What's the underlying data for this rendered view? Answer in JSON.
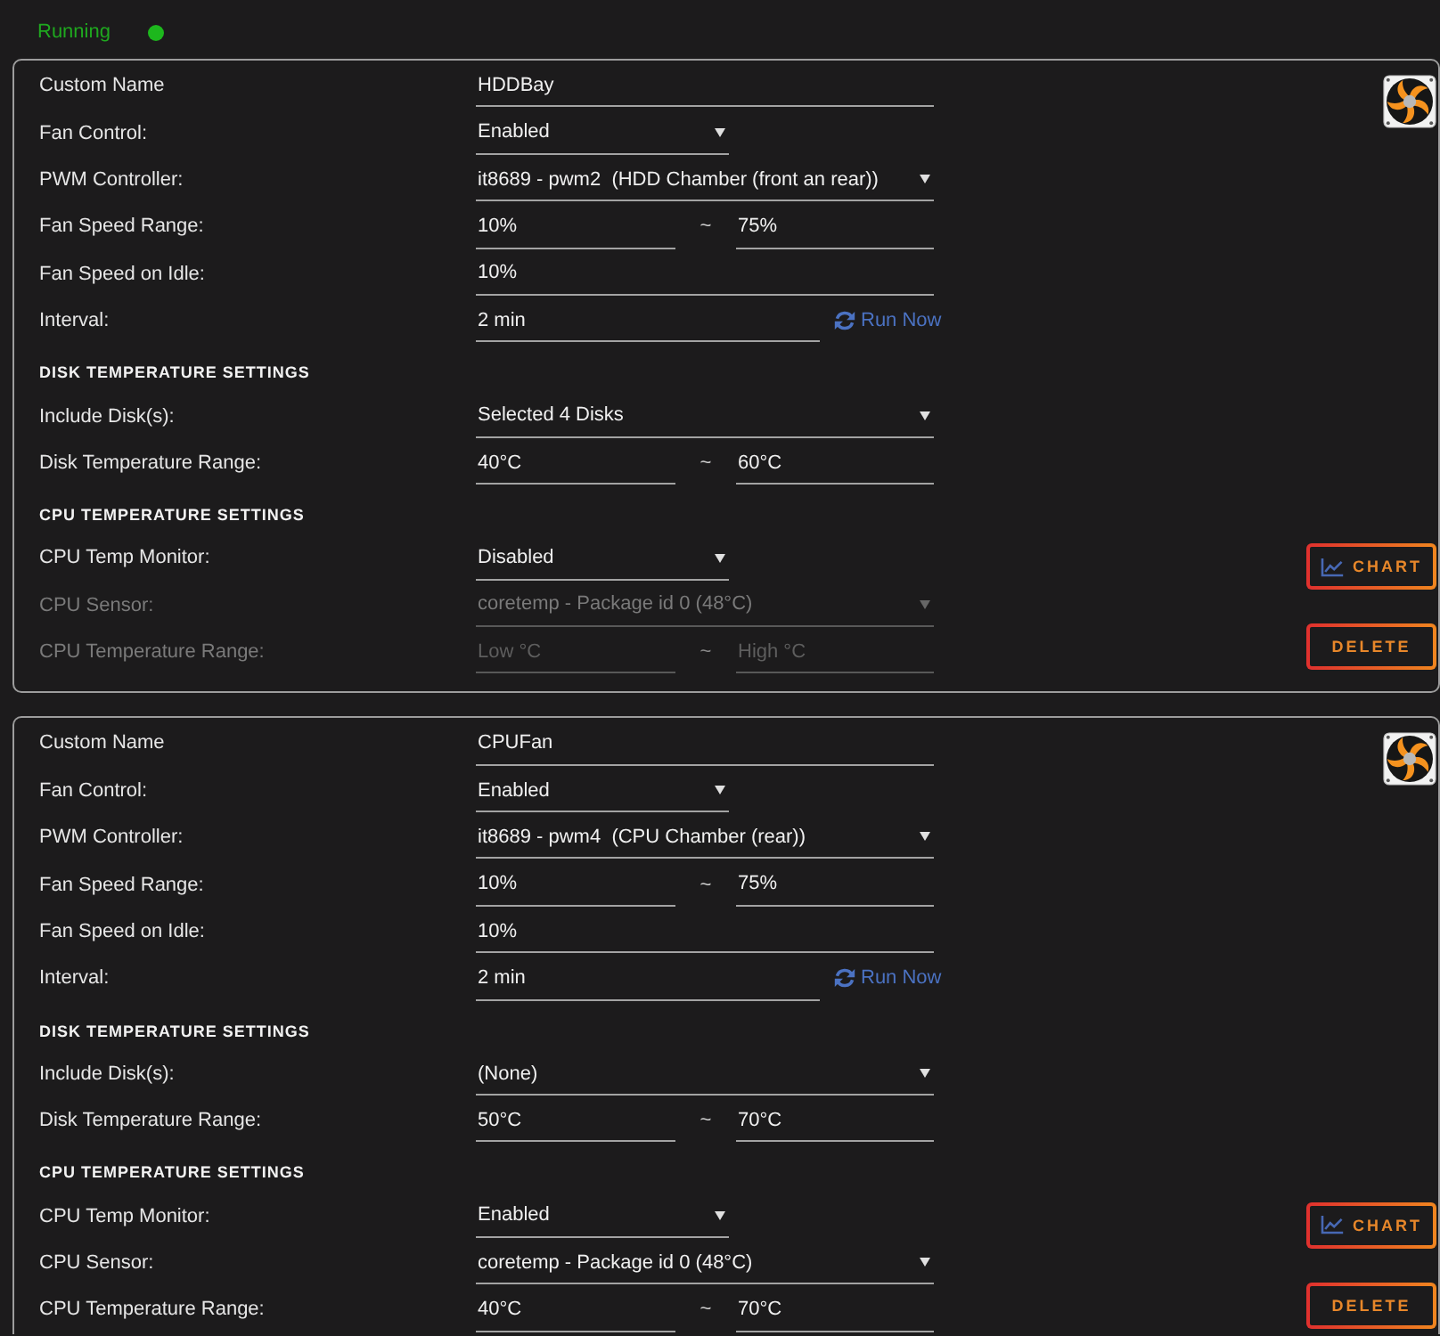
{
  "status": {
    "label": "Running",
    "on": true
  },
  "fans": [
    {
      "rows": [
        {
          "kind": "text",
          "label": "Custom Name",
          "value": "HDDBay",
          "disabled": false
        },
        {
          "kind": "switch",
          "label": "Fan Control:",
          "value": "Enabled",
          "disabled": false
        },
        {
          "kind": "select",
          "label": "PWM Controller:",
          "value": "it8689 - pwm2  (HDD Chamber (front an rear))",
          "disabled": false
        },
        {
          "kind": "range",
          "label": "Fan Speed Range:",
          "low": {
            "value": "10%"
          },
          "separator": "~",
          "high": {
            "value": "75%"
          },
          "disabled": false
        },
        {
          "kind": "text",
          "label": "Fan Speed on Idle:",
          "value": "10%",
          "disabled": false
        },
        {
          "kind": "interval",
          "label": "Interval:",
          "value": "2 min",
          "action": "Run Now",
          "disabled": false
        },
        {
          "kind": "heading",
          "label": "DISK TEMPERATURE SETTINGS",
          "disabled": false
        },
        {
          "kind": "select",
          "label": "Include Disk(s):",
          "value": "Selected 4 Disks",
          "disabled": false
        },
        {
          "kind": "range",
          "label": "Disk Temperature Range:",
          "low": {
            "value": "40°C"
          },
          "separator": "~",
          "high": {
            "value": "60°C"
          },
          "disabled": false
        },
        {
          "kind": "heading",
          "label": "CPU TEMPERATURE SETTINGS",
          "disabled": false
        },
        {
          "kind": "switch",
          "label": "CPU Temp Monitor:",
          "value": "Disabled",
          "disabled": false
        },
        {
          "kind": "select",
          "label": "CPU Sensor:",
          "value": "coretemp - Package id 0 (48°C)",
          "disabled": true
        },
        {
          "kind": "range",
          "label": "CPU Temperature Range:",
          "low": {
            "placeholder": "Low °C"
          },
          "separator": "~",
          "high": {
            "placeholder": "High °C"
          },
          "disabled": true
        }
      ],
      "buttons": [
        {
          "kind": "chart",
          "label": "CHART"
        },
        {
          "kind": "delete",
          "label": "DELETE"
        }
      ]
    },
    {
      "rows": [
        {
          "kind": "text",
          "label": "Custom Name",
          "value": "CPUFan",
          "disabled": false
        },
        {
          "kind": "switch",
          "label": "Fan Control:",
          "value": "Enabled",
          "disabled": false
        },
        {
          "kind": "select",
          "label": "PWM Controller:",
          "value": "it8689 - pwm4  (CPU Chamber (rear))",
          "disabled": false
        },
        {
          "kind": "range",
          "label": "Fan Speed Range:",
          "low": {
            "value": "10%"
          },
          "separator": "~",
          "high": {
            "value": "75%"
          },
          "disabled": false
        },
        {
          "kind": "text",
          "label": "Fan Speed on Idle:",
          "value": "10%",
          "disabled": false
        },
        {
          "kind": "interval",
          "label": "Interval:",
          "value": "2 min",
          "action": "Run Now",
          "disabled": false
        },
        {
          "kind": "heading",
          "label": "DISK TEMPERATURE SETTINGS",
          "disabled": false
        },
        {
          "kind": "select",
          "label": "Include Disk(s):",
          "value": "(None)",
          "disabled": false
        },
        {
          "kind": "range",
          "label": "Disk Temperature Range:",
          "low": {
            "value": "50°C"
          },
          "separator": "~",
          "high": {
            "value": "70°C"
          },
          "disabled": false
        },
        {
          "kind": "heading",
          "label": "CPU TEMPERATURE SETTINGS",
          "disabled": false
        },
        {
          "kind": "switch",
          "label": "CPU Temp Monitor:",
          "value": "Enabled",
          "disabled": false
        },
        {
          "kind": "select",
          "label": "CPU Sensor:",
          "value": "coretemp - Package id 0 (48°C)",
          "disabled": false
        },
        {
          "kind": "range",
          "label": "CPU Temperature Range:",
          "low": {
            "value": "40°C"
          },
          "separator": "~",
          "high": {
            "value": "70°C"
          },
          "disabled": false
        }
      ],
      "buttons": [
        {
          "kind": "chart",
          "label": "CHART"
        },
        {
          "kind": "delete",
          "label": "DELETE"
        }
      ]
    }
  ]
}
